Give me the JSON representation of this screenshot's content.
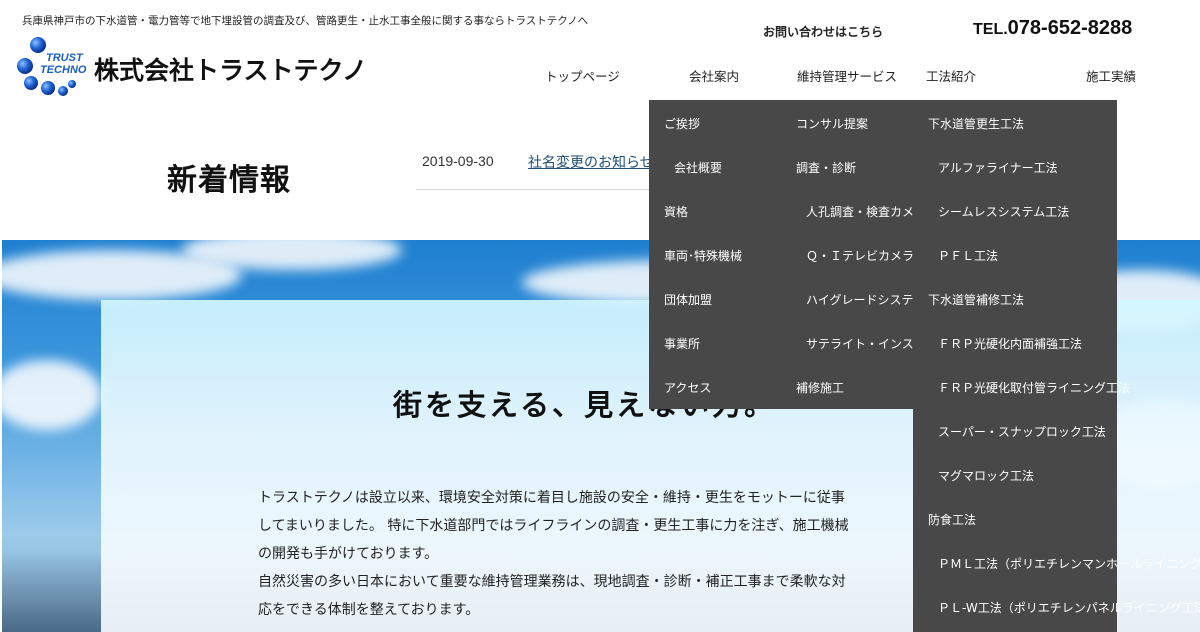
{
  "header": {
    "tagline": "兵庫県神戸市の下水道管・電力管等で地下埋設管の調査及び、管路更生・止水工事全般に関する事ならトラストテクノへ",
    "logo_mark_text_top": "TRUST",
    "logo_mark_text_bottom": "TECHNO",
    "company_name": "株式会社トラストテクノ",
    "contact_label": "お問い合わせはこちら",
    "tel_prefix": "TEL.",
    "tel_number": "078-652-8288"
  },
  "nav": {
    "items": [
      "トップページ",
      "会社案内",
      "維持管理サービス",
      "工法紹介",
      "施工実績"
    ]
  },
  "news": {
    "heading": "新着情報",
    "date": "2019-09-30",
    "title": "社名変更のお知らせ"
  },
  "hero": {
    "title": "街を支える、見えない力。",
    "paragraphs": [
      "トラストテクノは設立以来、環境安全対策に着目し施設の安全・維持・更生をモットーに従事",
      "してまいりました。 特に下水道部門ではライフラインの調査・更生工事に力を注ぎ、施工機械",
      "の開発も手がけております。",
      "自然災害の多い日本において重要な維持管理業務は、現地調査・診断・補正工事まで柔軟な対",
      "応をできる体制を整えております。"
    ]
  },
  "dropdown": {
    "company": [
      "ご挨拶",
      "会社概要",
      "資格",
      "車両･特殊機械",
      "団体加盟",
      "事業所",
      "アクセス"
    ],
    "service": [
      "コンサル提案",
      "調査・診断",
      "人孔調査・検査カメラ",
      "Ｑ・Ｉテレビカメラ",
      "ハイグレードシステム",
      "サテライト・インスペクション",
      "補修施工"
    ],
    "method": [
      "下水道管更生工法",
      "アルファライナー工法",
      "シームレスシステム工法",
      "ＰＦＬ工法",
      "下水道管補修工法",
      "ＦＲＰ光硬化内面補強工法",
      "ＦＲＰ光硬化取付管ライニング工法",
      "スーパー・スナップロック工法",
      "マグマロック工法",
      "防食工法",
      "ＰＭＬ工法（ポリエチレンマンホールライニング工法）",
      "ＰＬ-W工法（ポリエチレンパネルライニング工法）"
    ]
  },
  "colors": {
    "dropdown_bg": "#484848",
    "link": "#1f4e79",
    "logo_blue": "#1a5ec8"
  }
}
